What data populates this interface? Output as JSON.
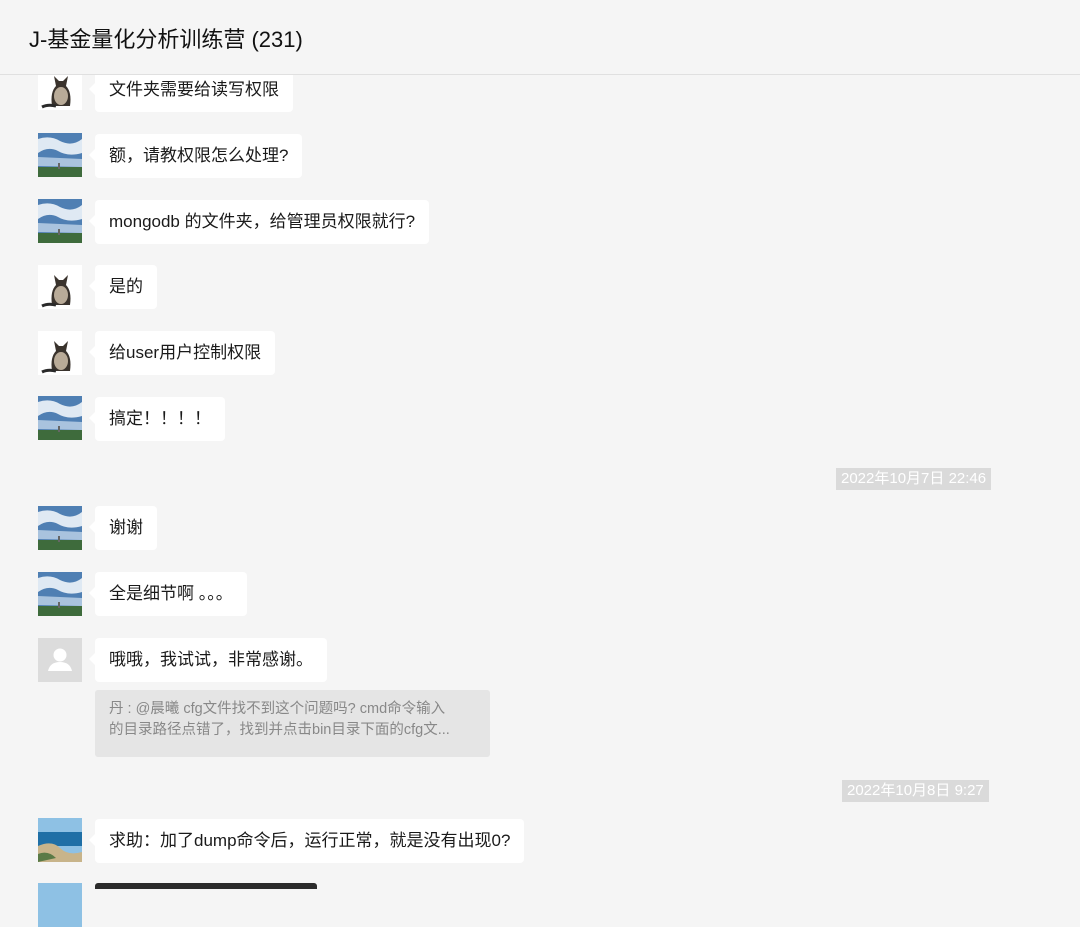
{
  "header": {
    "title": "J-基金量化分析训练营 (231)"
  },
  "messages": [
    {
      "avatar": "cat-avatar",
      "text": "文件夹需要给读写权限"
    },
    {
      "avatar": "sky-avatar",
      "text": "额，请教权限怎么处理?"
    },
    {
      "avatar": "sky-avatar",
      "text": "mongodb 的文件夹，给管理员权限就行?"
    },
    {
      "avatar": "cat-avatar",
      "text": "是的"
    },
    {
      "avatar": "cat-avatar",
      "text": "给user用户控制权限"
    },
    {
      "avatar": "sky-avatar",
      "text": "搞定！！！！"
    },
    {
      "avatar": "sky-avatar",
      "text": "谢谢"
    },
    {
      "avatar": "sky-avatar",
      "text": "全是细节啊 。。。"
    },
    {
      "avatar": "default-avatar",
      "text": "哦哦，我试试，非常感谢。"
    },
    {
      "avatar": "coast-avatar",
      "text": "求助：加了dump命令后，运行正常，就是没有出现0?"
    }
  ],
  "timestamps": [
    "2022年10月7日 22:46",
    "2022年10月8日 9:27"
  ],
  "quote": {
    "line1": "丹 : @晨曦 cfg文件找不到这个问题吗? cmd命令输入",
    "line2": "的目录路径点错了，找到并点击bin目录下面的cfg文..."
  },
  "colors": {
    "background": "#f5f5f5",
    "bubble": "#ffffff",
    "timestamp_bg": "#dadada",
    "quote_bg": "#e5e5e5"
  }
}
